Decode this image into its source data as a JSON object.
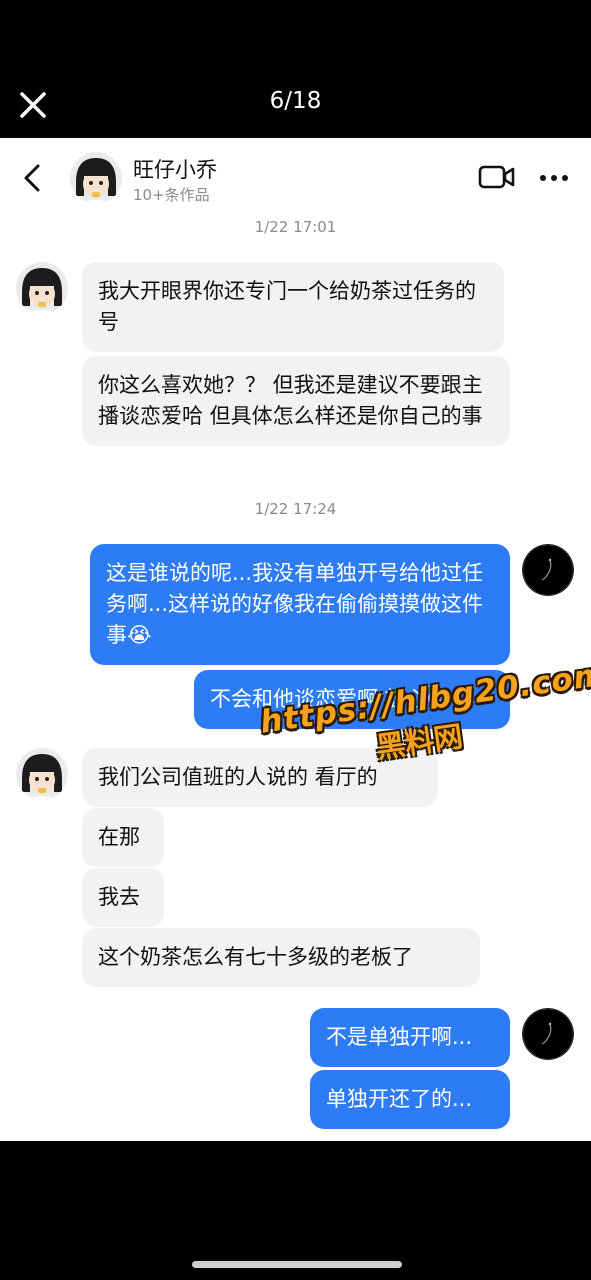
{
  "viewer": {
    "counter": "6/18",
    "close_icon": "close-icon"
  },
  "header": {
    "name": "旺仔小乔",
    "subtitle": "10+条作品",
    "back_icon": "back-chevron-icon",
    "video_icon": "video-call-icon",
    "more_icon": "more-dots-icon"
  },
  "timestamps": [
    "1/22 17:01",
    "1/22 17:24"
  ],
  "messages": [
    {
      "side": "in",
      "text": "我大开眼界你还专门一个给奶茶过任务的号"
    },
    {
      "side": "in",
      "text": "你这么喜欢她？？ 但我还是建议不要跟主播谈恋爱哈 但具体怎么样还是你自己的事"
    },
    {
      "side": "out",
      "text": "这是谁说的呢...我没有单独开号给他过任务啊...这样说的好像我在偷偷摸摸做这件事😭"
    },
    {
      "side": "out",
      "text": "不会和他谈恋爱啊 放心😜"
    },
    {
      "side": "in",
      "text": "我们公司值班的人说的 看厅的"
    },
    {
      "side": "in",
      "text": "在那"
    },
    {
      "side": "in",
      "text": "我去"
    },
    {
      "side": "in",
      "text": "这个奶茶怎么有七十多级的老板了"
    },
    {
      "side": "out",
      "text": "不是单独开啊..."
    },
    {
      "side": "out",
      "text": "单独开还了的..."
    }
  ],
  "watermark": {
    "url": "https://hlbg20.com",
    "brand": "黑料网"
  },
  "colors": {
    "outgoing_bubble": "#2d7cf6",
    "incoming_bubble": "#f2f2f4",
    "watermark": "#f6a21b"
  }
}
